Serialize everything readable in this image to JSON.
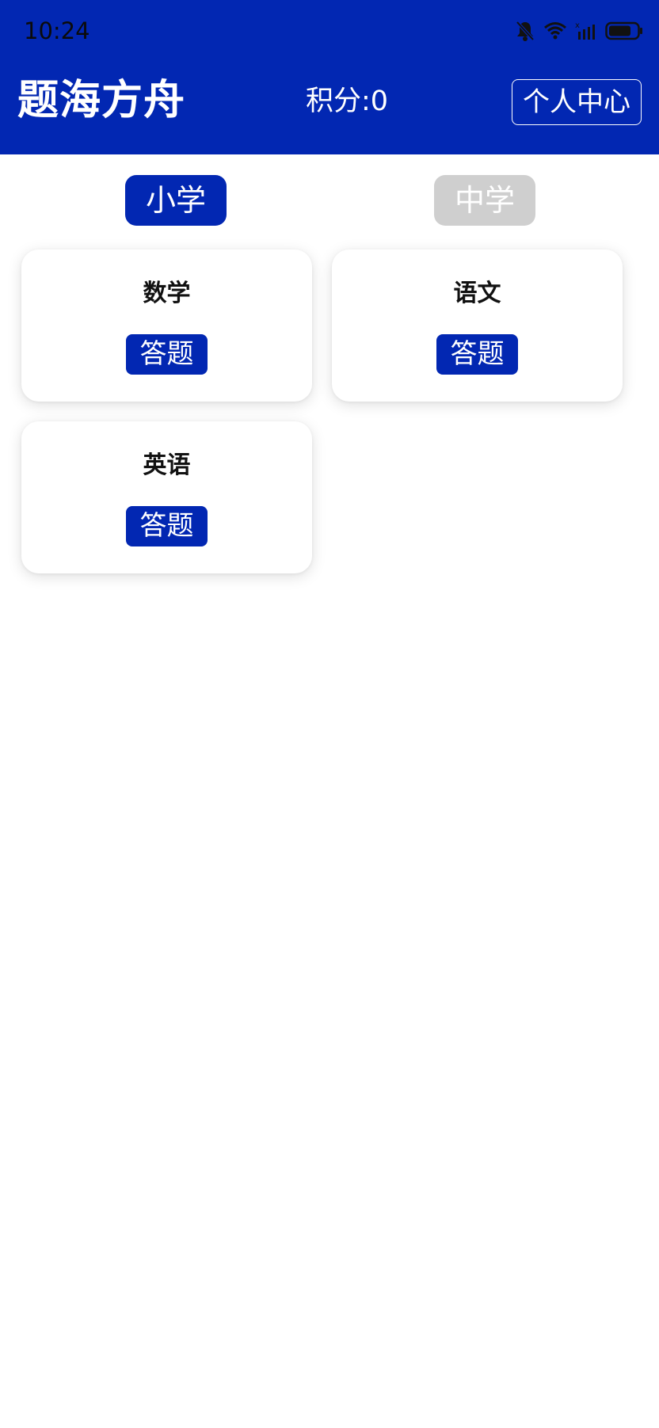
{
  "status_bar": {
    "time": "10:24",
    "icons": [
      "mute-bell-icon",
      "wifi-icon",
      "signal-icon",
      "battery-icon"
    ]
  },
  "header": {
    "title": "题海方舟",
    "score_text": "积分:0",
    "profile_button": "个人中心"
  },
  "level_tabs": [
    {
      "label": "小学",
      "selected": true
    },
    {
      "label": "中学",
      "selected": false
    }
  ],
  "subjects": [
    {
      "name": "数学",
      "button": "答题"
    },
    {
      "name": "语文",
      "button": "答题"
    },
    {
      "name": "英语",
      "button": "答题"
    }
  ],
  "colors": {
    "primary": "#0227B2",
    "tab_inactive": "#CFCFCF",
    "background": "#FFFFFF"
  }
}
